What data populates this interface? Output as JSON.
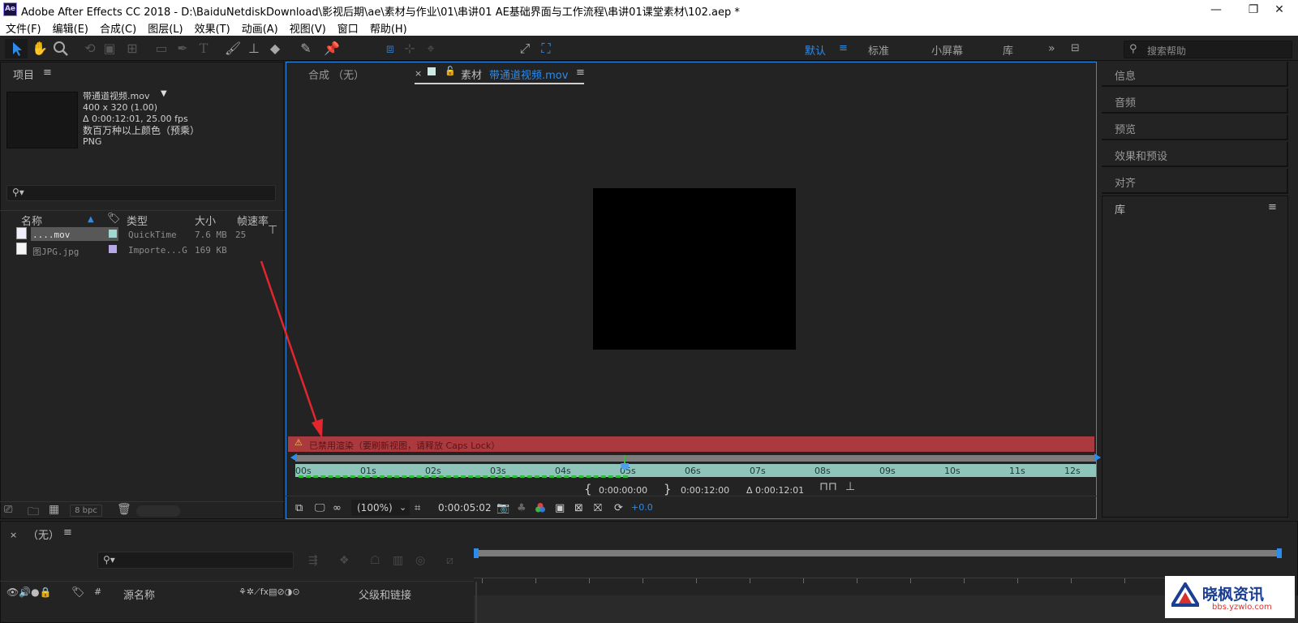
{
  "window": {
    "title": "Adobe After Effects CC 2018 - D:\\BaiduNetdiskDownload\\影视后期\\ae\\素材与作业\\01\\串讲01  AE基础界面与工作流程\\串讲01课堂素材\\102.aep *",
    "logo": "Ae"
  },
  "menu": [
    "文件(F)",
    "编辑(E)",
    "合成(C)",
    "图层(L)",
    "效果(T)",
    "动画(A)",
    "视图(V)",
    "窗口",
    "帮助(H)"
  ],
  "toolbar": {
    "snap_label": "对齐",
    "workspaces": [
      "默认",
      "标准",
      "小屏幕",
      "库"
    ],
    "active_workspace": "默认",
    "search_placeholder": "搜索帮助"
  },
  "project": {
    "title": "项目",
    "file": {
      "name": "带通道视频.mov",
      "dimensions": "400 x 320 (1.00)",
      "duration": "Δ 0:00:12:01, 25.00 fps",
      "colors": "数百万种以上颜色（预乘）",
      "codec": "PNG"
    },
    "search_placeholder": "",
    "columns": [
      "名称",
      "类型",
      "大小",
      "帧速率"
    ],
    "items": [
      {
        "name": "....mov",
        "type": "QuickTime",
        "size": "7.6 MB",
        "fps": "25",
        "label_color": "#a0d8cf",
        "selected": true
      },
      {
        "name": "图JPG.jpg",
        "type": "Importe...G",
        "size": "169 KB",
        "fps": "",
        "label_color": "#b7a8e8",
        "selected": false
      }
    ],
    "bpc": "8 bpc"
  },
  "viewer": {
    "comp_tab": "合成 （无）",
    "footage_tab_prefix": "素材",
    "footage_tab_name": "带通道视频.mov",
    "warning": "已禁用渲染（要刷新视图，请释放 Caps Lock）",
    "ruler_ticks": [
      "00s",
      "01s",
      "02s",
      "03s",
      "04s",
      "05s",
      "06s",
      "07s",
      "08s",
      "09s",
      "10s",
      "11s",
      "12s"
    ],
    "in_point": "0:00:00:00",
    "out_point": "0:00:12:00",
    "duration": "Δ 0:00:12:01",
    "zoom": "(100%)",
    "current_time": "0:00:05:02",
    "exposure": "+0.0",
    "playhead_seconds": 5.08,
    "cached_seconds": 5.0
  },
  "right_panels": [
    "信息",
    "音频",
    "预览",
    "效果和预设",
    "对齐",
    "库"
  ],
  "timeline": {
    "tab": "（无）",
    "search_placeholder": "",
    "source_name": "源名称",
    "parent_link": "父级和链接",
    "col_hash": "#"
  },
  "watermark": {
    "name": "晓枫资讯",
    "url": "bbs.yzwlo.com"
  },
  "colors": {
    "accent": "#2d8ceb",
    "warning": "#ab3a3f",
    "ruler": "#8fc4bb",
    "cache": "#2fbb3c",
    "annotation_arrow": "#e3262e"
  }
}
